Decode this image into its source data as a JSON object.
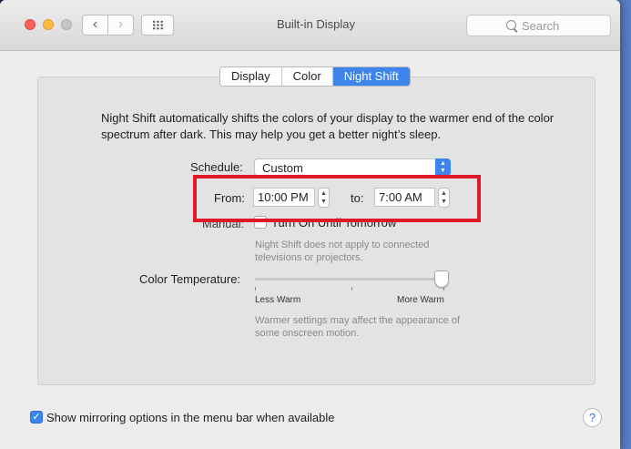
{
  "window": {
    "title": "Built-in Display"
  },
  "toolbar": {
    "back_glyph": "‹",
    "forward_glyph": "›",
    "search_placeholder": "Search"
  },
  "tabs": [
    {
      "label": "Display",
      "active": false
    },
    {
      "label": "Color",
      "active": false
    },
    {
      "label": "Night Shift",
      "active": true
    }
  ],
  "night_shift": {
    "description": "Night Shift automatically shifts the colors of your display to the warmer end of the color spectrum after dark. This may help you get a better night’s sleep.",
    "schedule_label": "Schedule:",
    "schedule_value": "Custom",
    "from_label": "From:",
    "from_value": "10:00 PM",
    "to_label": "to:",
    "to_value": "7:00 AM",
    "manual_label": "Manual:",
    "manual_checkbox_label": "Turn On Until Tomorrow",
    "manual_note": "Night Shift does not apply to connected televisions or projectors.",
    "temp_label": "Color Temperature:",
    "less_warm": "Less Warm",
    "more_warm": "More Warm",
    "temp_note": "Warmer settings may affect the appearance of some onscreen motion.",
    "temp_level": 1.0
  },
  "footer": {
    "mirroring_label": "Show mirroring options in the menu bar when available",
    "mirroring_checked": true,
    "help_glyph": "?"
  },
  "colors": {
    "accent": "#3d84ec",
    "highlight_box": "#e0192a"
  }
}
